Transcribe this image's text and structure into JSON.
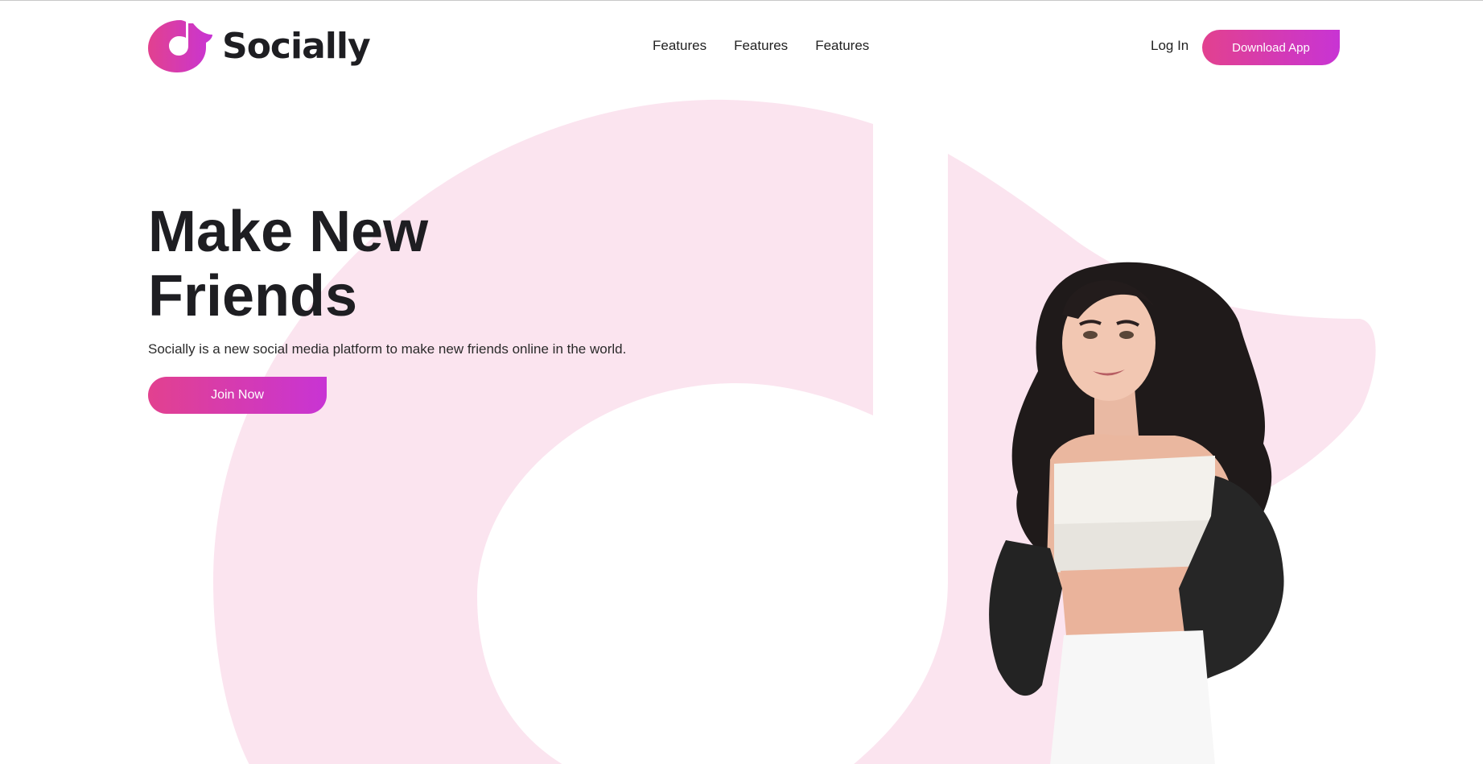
{
  "brand": {
    "name": "Socially",
    "accent_start": "#e2418f",
    "accent_end": "#c834d4",
    "background_shape_color": "#fbe4ef"
  },
  "nav": {
    "items": [
      {
        "label": "Features"
      },
      {
        "label": "Features"
      },
      {
        "label": "Features"
      }
    ],
    "login_label": "Log In",
    "download_label": "Download App"
  },
  "hero": {
    "title_line1": "Make New",
    "title_line2": "Friends",
    "subtitle": "Socially is a new social media platform to make new friends online in the world.",
    "cta_label": "Join Now"
  },
  "icons": {
    "logo": "music-note-icon",
    "background": "music-note-shape"
  }
}
